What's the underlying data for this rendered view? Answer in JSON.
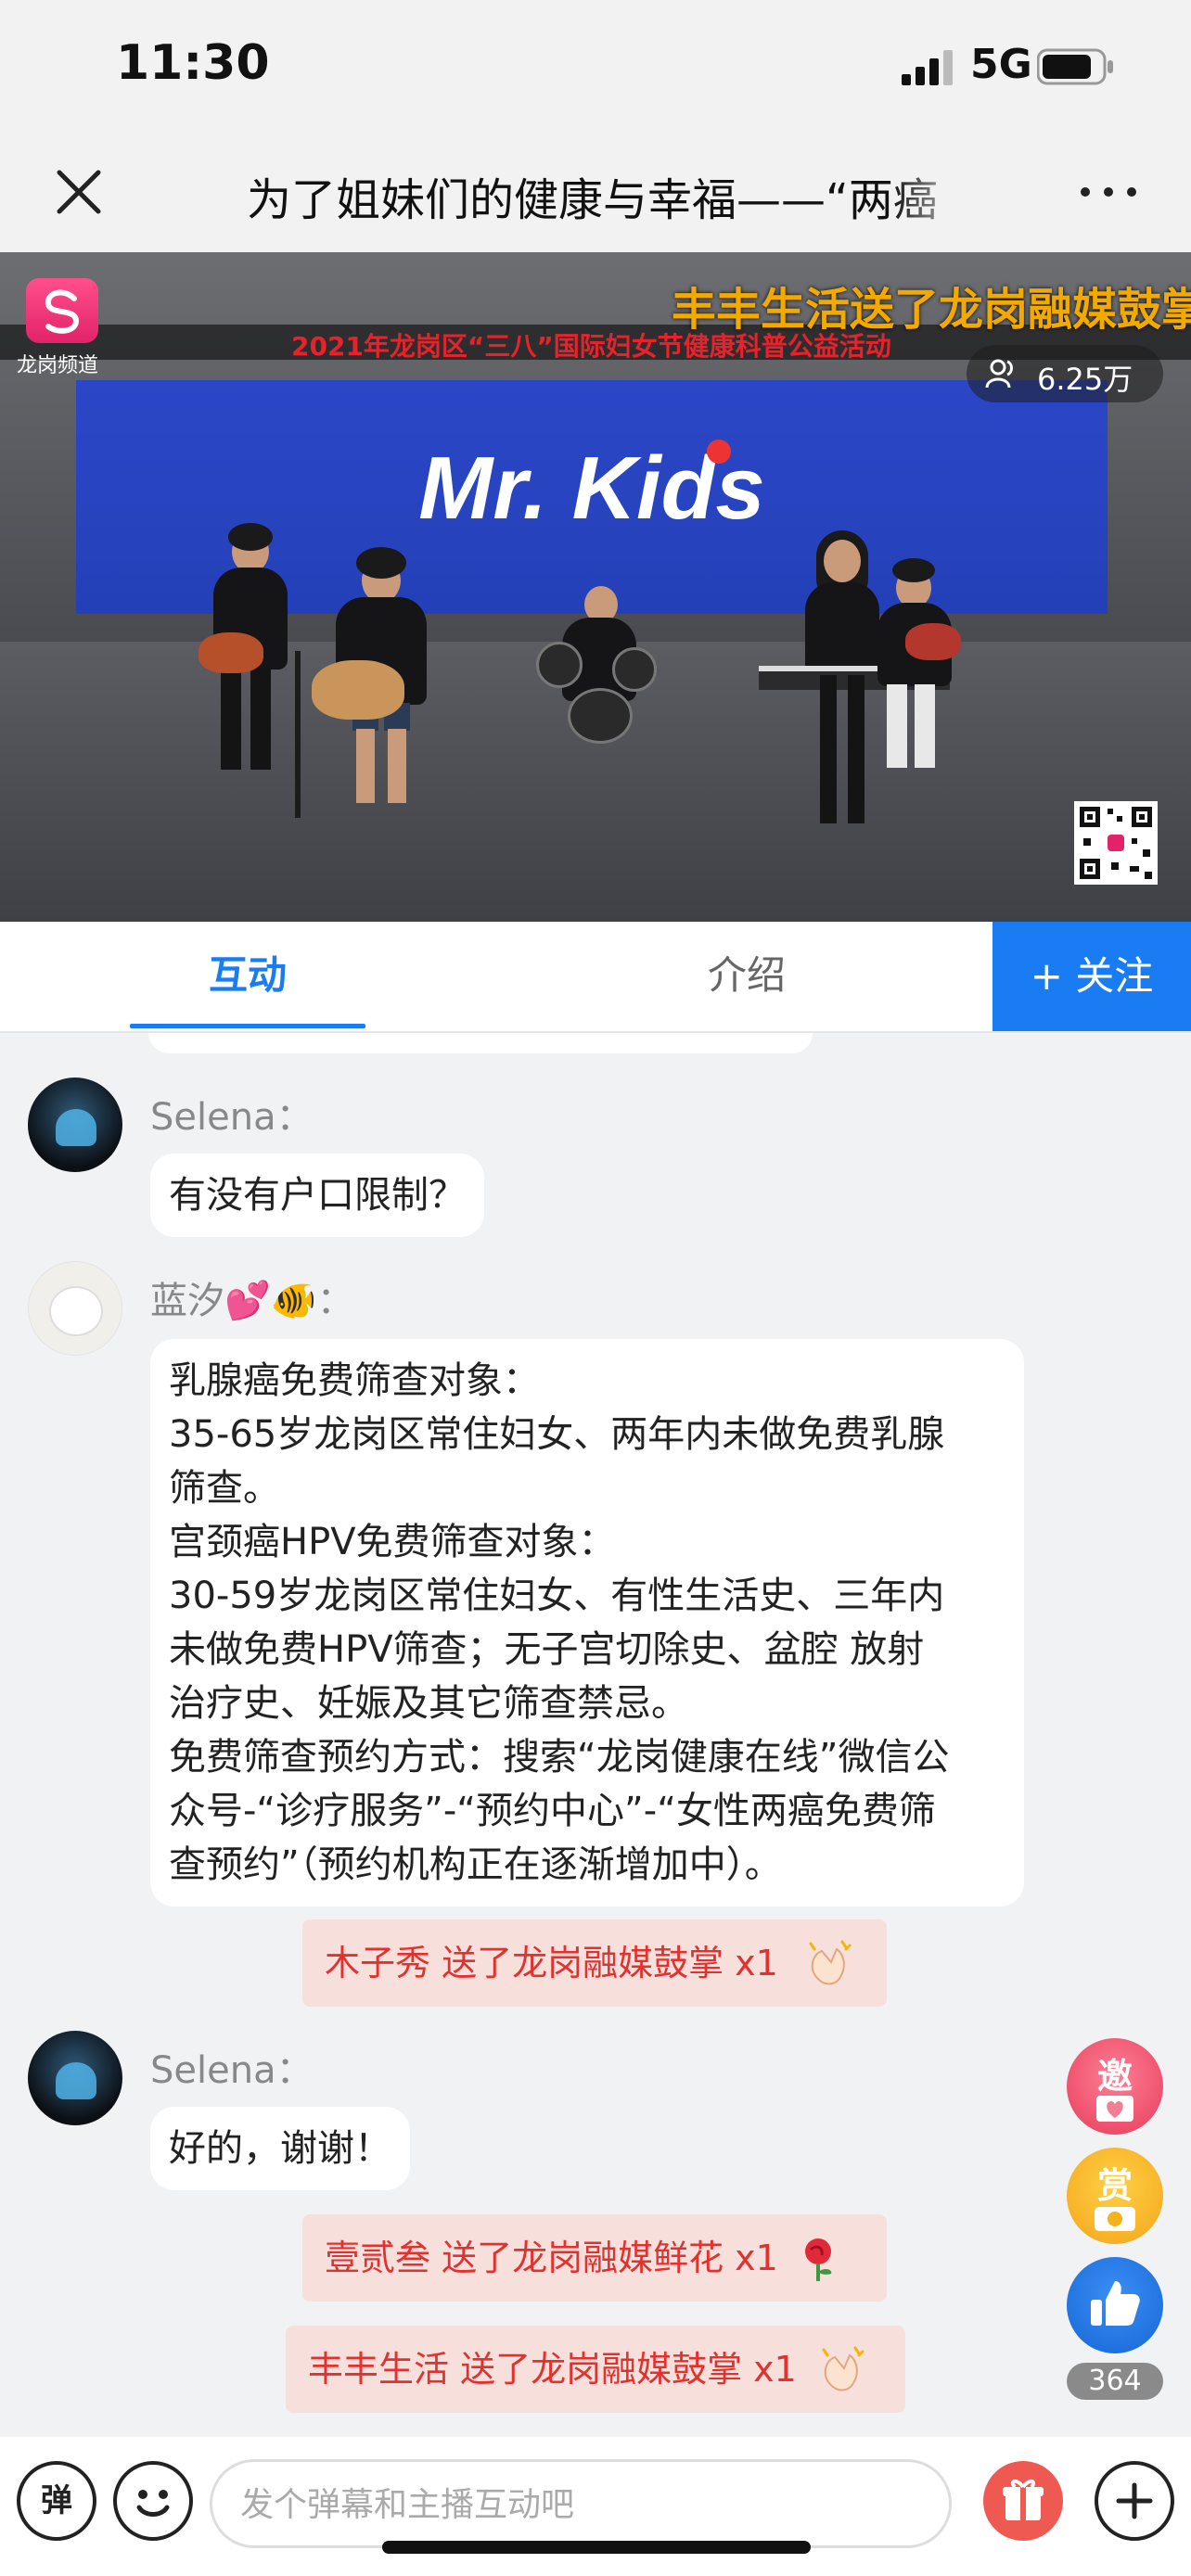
{
  "status_bar": {
    "time": "11:30",
    "network": "5G"
  },
  "nav": {
    "title": "为了姐妹们的健康与幸福——“两癌"
  },
  "video": {
    "screen_text": "Mr. Kids",
    "ticker_red": "2021年龙岗区“三八”国际妇女节健康科普公益活动",
    "ticker_yellow": "丰丰生活送了龙岗融媒鼓掌",
    "channel_label": "龙岗频道",
    "viewers": "6.25万"
  },
  "tabs": {
    "active": "互动",
    "intro": "介绍",
    "follow": "+ 关注"
  },
  "chat": {
    "msg1": {
      "name": "Selena：",
      "text": "有没有户口限制？"
    },
    "msg2": {
      "name": "蓝汐💕🐠：",
      "lines": [
        "乳腺癌免费筛查对象：",
        "35-65岁龙岗区常住妇女、两年内未做免费乳腺",
        "筛查。",
        "宫颈癌HPV免费筛查对象：",
        "30-59岁龙岗区常住妇女、有性生活史、三年内",
        "未做免费HPV筛查；无子宫切除史、盆腔 放射",
        "治疗史、妊娠及其它筛查禁忌。",
        "免费筛查预约方式：搜索“龙岗健康在线”微信公",
        "众号-“诊疗服务”-“预约中心”-“女性两癌免费筛",
        "查预约”（预约机构正在逐渐增加中）。"
      ]
    },
    "gift1": "木子秀 送了龙岗融媒鼓掌 x1",
    "msg3": {
      "name": "Selena：",
      "text": "好的，谢谢！"
    },
    "gift2": "壹贰叁 送了龙岗融媒鲜花 x1",
    "gift3": "丰丰生活 送了龙岗融媒鼓掌 x1"
  },
  "side": {
    "invite": "邀",
    "reward": "赏",
    "like_count": "364"
  },
  "bottom": {
    "danmu": "弹",
    "placeholder": "发个弹幕和主播互动吧"
  },
  "colors": {
    "accent": "#1a7cf3",
    "gift_bg": "#f7dfdc",
    "gift_text": "#e1322f"
  }
}
